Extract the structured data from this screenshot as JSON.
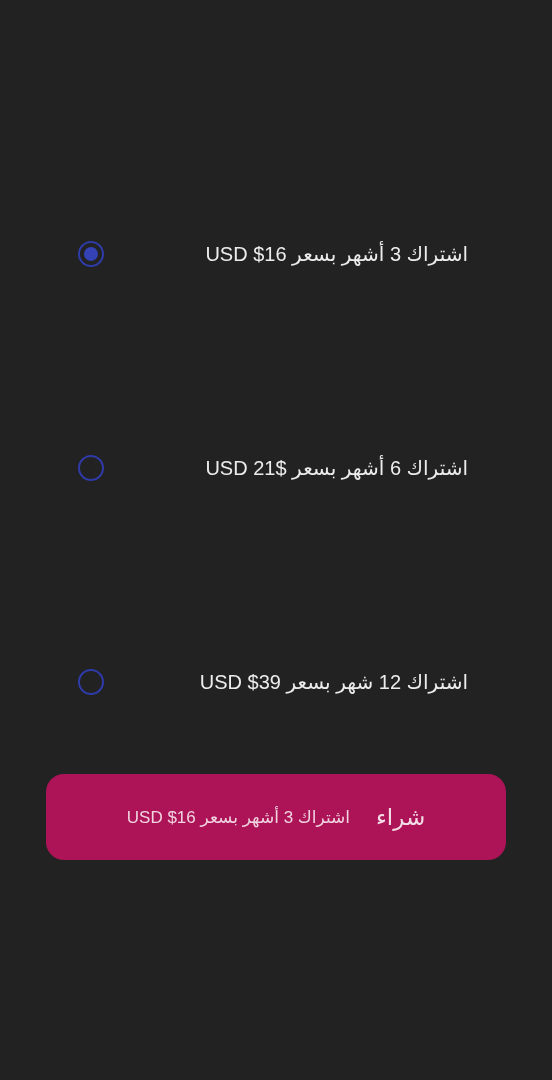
{
  "plans": [
    {
      "label": "اشتراك 3 أشهر بسعر USD $16",
      "selected": true
    },
    {
      "label": "اشتراك 6 أشهر بسعر USD 21$",
      "selected": false
    },
    {
      "label": "اشتراك 12 شهر بسعر USD $39",
      "selected": false
    }
  ],
  "buy_button": {
    "label": "شراء",
    "summary": "اشتراك 3 أشهر بسعر USD $16"
  }
}
